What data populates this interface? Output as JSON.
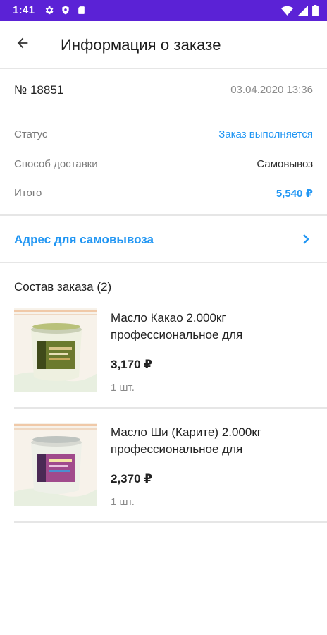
{
  "status_bar": {
    "time": "1:41",
    "icons": [
      "gear-icon",
      "shield-icon",
      "sd-card-icon",
      "wifi-icon",
      "signal-icon",
      "battery-icon"
    ]
  },
  "toolbar": {
    "title": "Информация о заказе",
    "back_icon": "arrow-left-icon"
  },
  "order": {
    "number": "№ 18851",
    "date": "03.04.2020 13:36"
  },
  "info": {
    "status_label": "Статус",
    "status_value": "Заказ выполняется",
    "delivery_label": "Способ доставки",
    "delivery_value": "Самовывоз",
    "total_label": "Итого",
    "total_value": "5,540 ₽"
  },
  "pickup": {
    "label": "Адрес для самовывоза",
    "icon": "chevron-right-icon"
  },
  "composition": {
    "title": "Состав заказа (2)",
    "items": [
      {
        "name": "Масло Какао 2.000кг профессиональное для",
        "price": "3,170 ₽",
        "qty": "1 шт.",
        "label_color": "#6b7a2e"
      },
      {
        "name": "Масло Ши (Карите) 2.000кг профессиональное для",
        "price": "2,370 ₽",
        "qty": "1 шт.",
        "label_color": "#a04b8c"
      }
    ]
  },
  "colors": {
    "status_bar": "#5b22d6",
    "accent": "#2196f3"
  }
}
